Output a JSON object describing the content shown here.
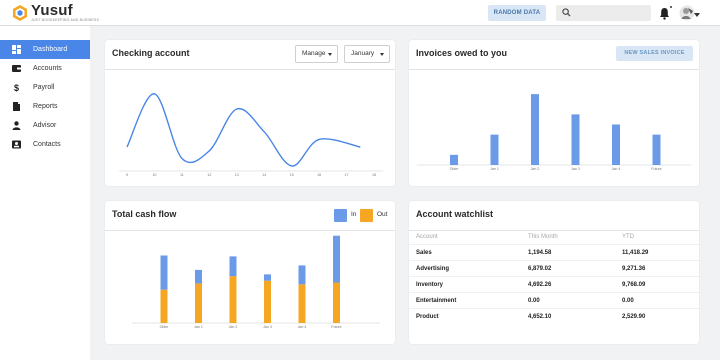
{
  "brand": {
    "name": "Yusuf",
    "tagline": "JUST BOOKKEEPING AND BUSINESS"
  },
  "topbar": {
    "random_label": "RANDOM DATA",
    "search_placeholder": "",
    "search_value": ""
  },
  "sidebar": {
    "items": [
      {
        "label": "Dashboard",
        "icon": "dashboard-icon",
        "active": true
      },
      {
        "label": "Accounts",
        "icon": "wallet-icon",
        "active": false
      },
      {
        "label": "Payroll",
        "icon": "dollar-icon",
        "active": false
      },
      {
        "label": "Reports",
        "icon": "document-icon",
        "active": false
      },
      {
        "label": "Advisor",
        "icon": "person-icon",
        "active": false
      },
      {
        "label": "Contacts",
        "icon": "contact-card-icon",
        "active": false
      }
    ]
  },
  "colors": {
    "accent": "#4a86e8",
    "series_in": "#6b9ae8",
    "series_out": "#f5a623",
    "line": "#4a86e8"
  },
  "checking": {
    "title": "Checking account",
    "manage_label": "Manage",
    "month_label": "January"
  },
  "invoices": {
    "title": "Invoices owed to you",
    "button_label": "NEW SALES INVOICE"
  },
  "cashflow": {
    "title": "Total cash flow",
    "legend_in": "In",
    "legend_out": "Out"
  },
  "watchlist": {
    "title": "Account watchlist",
    "headers": [
      "Account",
      "This Month",
      "YTD"
    ],
    "rows": [
      [
        "Sales",
        "1,194.58",
        "11,418.29"
      ],
      [
        "Advertising",
        "6,879.02",
        "9,271.36"
      ],
      [
        "Inventory",
        "4,692.26",
        "9,768.09"
      ],
      [
        "Entertainment",
        "0.00",
        "0.00"
      ],
      [
        "Product",
        "4,652.10",
        "2,529.90"
      ]
    ]
  },
  "chart_data": [
    {
      "type": "line",
      "x": [
        9,
        10,
        11,
        12,
        13,
        14,
        15,
        16,
        17,
        18
      ],
      "x_tick_labels": [
        "9",
        "10",
        "11",
        "12",
        "13",
        "14",
        "15",
        "16",
        "17",
        "18"
      ],
      "y": [
        0.25,
        0.95,
        0.1,
        0.2,
        0.75,
        0.45,
        0.0,
        0.35,
        0.25
      ],
      "y_at_x": [
        9,
        10,
        11,
        12,
        13,
        14,
        15,
        16,
        17.5
      ],
      "grid": false
    },
    {
      "type": "bar",
      "categories": [
        "Older",
        "Jan 1",
        "Jan 2",
        "Jan 3",
        "Jan 4",
        "Future"
      ],
      "values": [
        10,
        30,
        70,
        50,
        40,
        30
      ],
      "ylim": [
        0,
        80
      ],
      "grid": false
    },
    {
      "type": "bar",
      "stacked": true,
      "categories": [
        "Older",
        "Jan 1",
        "Jan 2",
        "Jan 3",
        "Jan 4",
        "Future"
      ],
      "series": [
        {
          "name": "Out",
          "values": [
            37,
            44,
            52,
            47,
            43,
            45
          ]
        },
        {
          "name": "In",
          "values": [
            38,
            15,
            22,
            7,
            21,
            52
          ]
        }
      ],
      "ylim": [
        0,
        100
      ],
      "legend": "top-right",
      "grid": false
    }
  ]
}
